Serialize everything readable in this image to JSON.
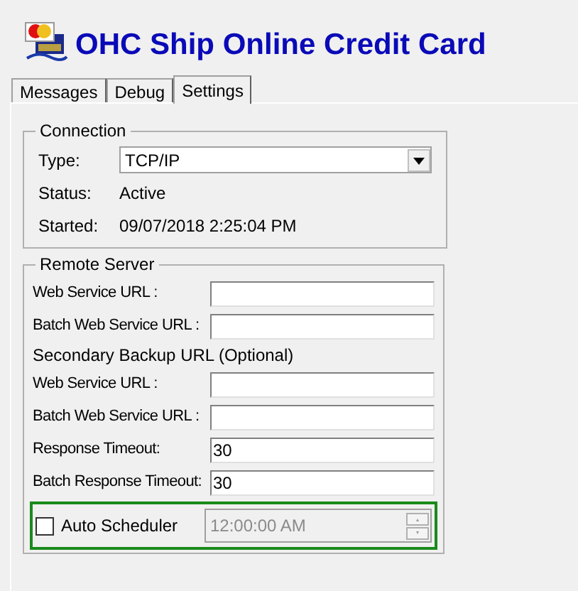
{
  "app": {
    "title": "OHC Ship Online Credit Card"
  },
  "tabs": [
    {
      "label": "Messages",
      "selected": false
    },
    {
      "label": "Debug",
      "selected": false
    },
    {
      "label": "Settings",
      "selected": true
    }
  ],
  "connection": {
    "title": "Connection",
    "fields": [
      {
        "kind": "dropdown",
        "label": "Type:",
        "value": "TCP/IP"
      },
      {
        "kind": "text",
        "label": "Status:",
        "value": "Active"
      },
      {
        "kind": "text",
        "label": "Started:",
        "value": "09/07/2018 2:25:04 PM"
      }
    ]
  },
  "remote_server": {
    "title": "Remote Server",
    "rows": [
      {
        "kind": "input",
        "label": "Web Service URL :"
      },
      {
        "kind": "input",
        "label": "Batch Web Service URL :"
      },
      {
        "kind": "heading",
        "label": "Secondary Backup URL (Optional)"
      },
      {
        "kind": "input",
        "label": "Web Service URL :"
      },
      {
        "kind": "input",
        "label": "Batch Web Service URL :"
      },
      {
        "kind": "input",
        "label": "Response Timeout:",
        "value": "30"
      },
      {
        "kind": "input",
        "label": "Batch Response Timeout:",
        "value": "30"
      },
      {
        "kind": "scheduler",
        "label": "Auto Scheduler",
        "checked": false,
        "disabled": true,
        "value": "12:00:00 AM"
      }
    ]
  }
}
